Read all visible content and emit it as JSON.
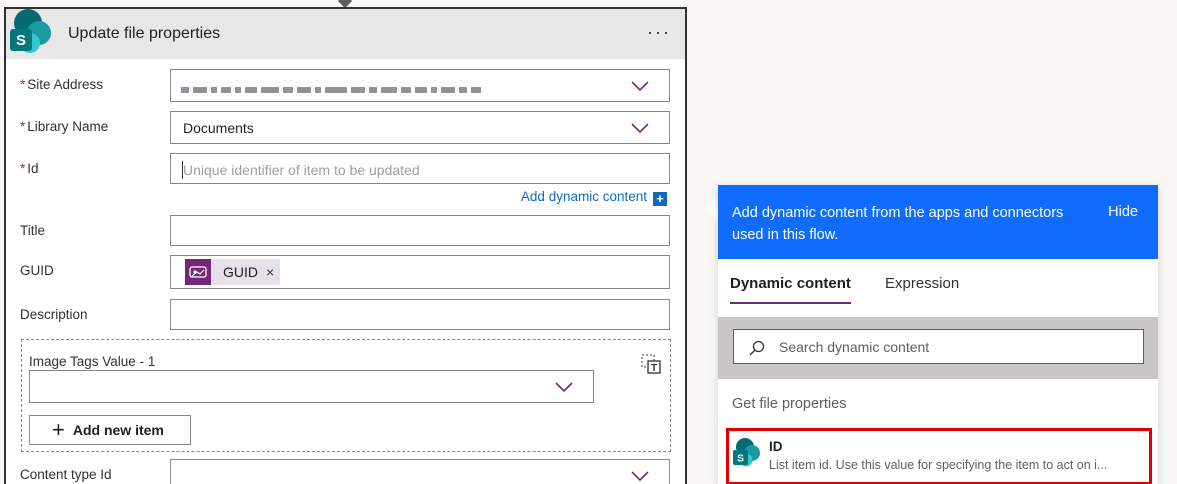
{
  "action_card": {
    "title": "Update file properties",
    "more_label": "···",
    "required_marker": "*",
    "fields": {
      "site_address": {
        "label": "Site Address"
      },
      "library_name": {
        "label": "Library Name",
        "value": "Documents"
      },
      "id": {
        "label": "Id",
        "placeholder": "Unique identifier of item to be updated"
      },
      "title": {
        "label": "Title"
      },
      "guid": {
        "label": "GUID",
        "token": "GUID",
        "token_remove": "×"
      },
      "description": {
        "label": "Description"
      },
      "image_tags": {
        "label": "Image Tags Value - 1",
        "add_item_label": "Add new item"
      },
      "content_type_id": {
        "label": "Content type Id"
      }
    },
    "add_dynamic_content": {
      "label": "Add dynamic content",
      "icon": "+"
    }
  },
  "dynamic_flyout": {
    "header_text": "Add dynamic content from the apps and connectors used in this flow.",
    "hide_label": "Hide",
    "tabs": [
      "Dynamic content",
      "Expression"
    ],
    "active_tab": "Dynamic content",
    "search_placeholder": "Search dynamic content",
    "section_title": "Get file properties",
    "items": [
      {
        "name": "ID",
        "description": "List item id. Use this value for specifying the item to act on i..."
      }
    ]
  },
  "colors": {
    "flyout_header": "#0f6cfd",
    "token_bg": "#742774",
    "highlight": "#e00000",
    "link": "#0f6cbd",
    "required": "#a4262c"
  }
}
